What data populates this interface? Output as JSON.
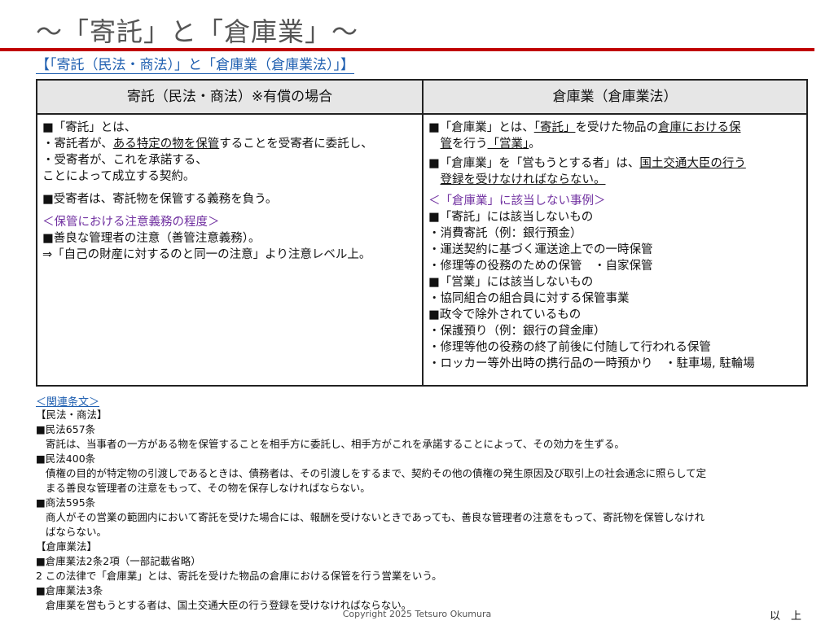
{
  "title": "～「寄託」と「倉庫業」～",
  "subtitle": "【「寄託（民法・商法）」と「倉庫業（倉庫業法）」】",
  "table": {
    "left": {
      "header": "寄託（民法・商法）※有償の場合",
      "l1": "■「寄託」とは、",
      "l2a": "・寄託者が、",
      "l2b": "ある特定の物を保管",
      "l2c": "することを受寄者に委託し、",
      "l3": "・受寄者が、これを承諾する、",
      "l4": "ことによって成立する契約。",
      "l5": "■受寄者は、寄託物を保管する義務を負う。",
      "l6": "＜保管における注意義務の程度＞",
      "l7": "■善良な管理者の注意（善管注意義務）。",
      "l8": "⇒「自己の財産に対するのと同一の注意」より注意レベル上。"
    },
    "right": {
      "header": "倉庫業（倉庫業法）",
      "r1a": "■「倉庫業」とは、",
      "r1b": "「寄託」",
      "r1c": "を受けた物品の",
      "r1d": "倉庫における保",
      "r2a": "管",
      "r2b": "を行う",
      "r2c": "「営業」",
      "r2d": "。",
      "r3a": "■「倉庫業」を「営もうとする者」は、",
      "r3b": "国土交通大臣の行う",
      "r4": "登録を受けなければならない。",
      "r5": "＜「倉庫業」に該当しない事例＞",
      "r6": "■「寄託」には該当しないもの",
      "r7": "・消費寄託（例：銀行預金）",
      "r8": "・運送契約に基づく運送途上での一時保管",
      "r9": "・修理等の役務のための保管　・自家保管",
      "r10": "■「営業」には該当しないもの",
      "r11": "・協同組合の組合員に対する保管事業",
      "r12": "■政令で除外されているもの",
      "r13": "・保護預り（例：銀行の貸金庫）",
      "r14": "・修理等他の役務の終了前後に付随して行われる保管",
      "r15": "・ロッカー等外出時の携行品の一時預かり　・駐車場, 駐輪場"
    }
  },
  "related": {
    "link": "＜関連条文＞",
    "n1": "【民法・商法】",
    "n2": "■民法657条",
    "n3": "寄託は、当事者の一方がある物を保管することを相手方に委託し、相手方がこれを承諾することによって、その効力を生ずる。",
    "n4": "■民法400条",
    "n5": "債権の目的が特定物の引渡しであるときは、債務者は、その引渡しをするまで、契約その他の債権の発生原因及び取引上の社会通念に照らして定",
    "n6": "まる善良な管理者の注意をもって、その物を保存しなければならない。",
    "n7": "■商法595条",
    "n8": "商人がその営業の範囲内において寄託を受けた場合には、報酬を受けないときであっても、善良な管理者の注意をもって、寄託物を保管しなけれ",
    "n9": "ばならない。",
    "n10": "【倉庫業法】",
    "n11": "■倉庫業法2条2項（一部記載省略）",
    "n12": "2 この法律で「倉庫業」とは、寄託を受けた物品の倉庫における保管を行う営業をいう。",
    "n13": "■倉庫業法3条",
    "n14": "倉庫業を営もうとする者は、国土交通大臣の行う登録を受けなければならない。"
  },
  "footer": {
    "copyright": "Copyright 2025 Tetsuro Okumura",
    "end": "以　上"
  },
  "colors": {
    "accent_red": "#c00000",
    "link_blue": "#1f5fb0",
    "purple": "#7030a0"
  }
}
